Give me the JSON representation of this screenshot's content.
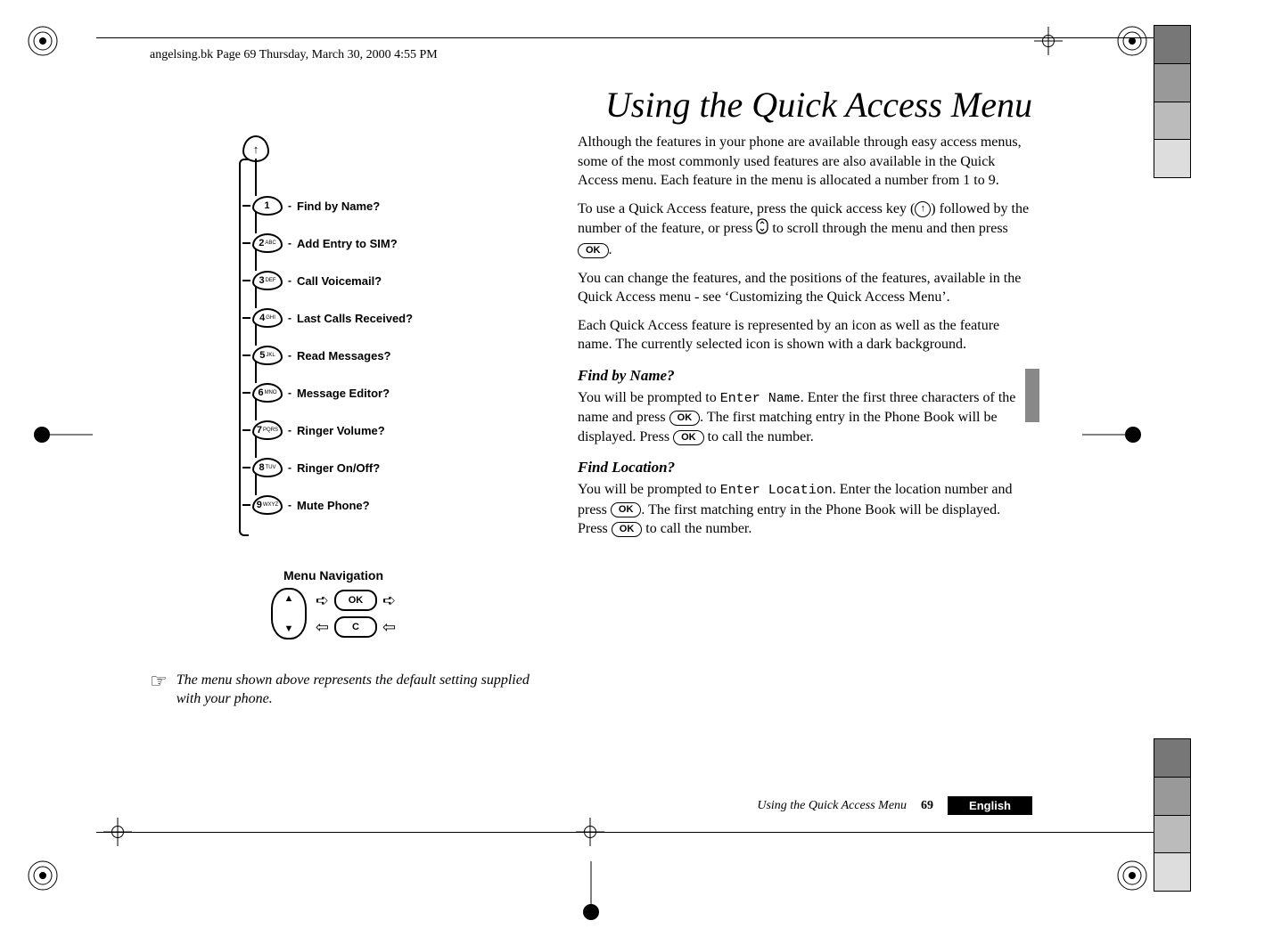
{
  "header_path": "angelsing.bk  Page 69  Thursday, March 30, 2000  4:55 PM",
  "title": "Using the Quick Access Menu",
  "menu_items": [
    {
      "key_num": "1",
      "key_letters": "",
      "label": "Find by Name?"
    },
    {
      "key_num": "2",
      "key_letters": "ABC",
      "label": "Add Entry to SIM?"
    },
    {
      "key_num": "3",
      "key_letters": "DEF",
      "label": "Call Voicemail?"
    },
    {
      "key_num": "4",
      "key_letters": "GHI",
      "label": "Last Calls Received?"
    },
    {
      "key_num": "5",
      "key_letters": "JKL",
      "label": "Read Messages?"
    },
    {
      "key_num": "6",
      "key_letters": "MNO",
      "label": "Message Editor?"
    },
    {
      "key_num": "7",
      "key_letters": "PQRS",
      "label": "Ringer Volume?"
    },
    {
      "key_num": "8",
      "key_letters": "TUV",
      "label": "Ringer On/Off?"
    },
    {
      "key_num": "9",
      "key_letters": "WXYZ",
      "label": "Mute Phone?"
    }
  ],
  "top_key_glyph": "↑",
  "nav_title": "Menu Navigation",
  "nav_ok": "OK",
  "nav_c": "C",
  "rocker_up": "▲",
  "rocker_down": "▼",
  "arrow_right": "➪",
  "arrow_left": "⇦",
  "note_text": "The menu shown above represents the default setting supplied with your phone.",
  "body": {
    "p1": "Although the features in your phone are available through easy access menus, some of the most commonly used features are also available in the Quick Access menu. Each feature in the menu is allocated a number from 1 to 9.",
    "p2a": "To use a Quick Access feature, press the quick access key (",
    "p2b": ") followed by the number of the feature, or press ",
    "p2c": " to scroll through the menu and then press ",
    "p2d": ".",
    "p3": "You can change the features, and the positions of the features, available in the Quick Access menu - see ‘Customizing the Quick Access Menu’.",
    "p4": "Each Quick Access feature is represented by an icon as well as the feature name. The currently selected icon is shown with a dark background.",
    "h_find_name": "Find by Name?",
    "fn_a": "You will be prompted to ",
    "fn_prompt": "Enter Name",
    "fn_b": ". Enter the first three characters of the name and press ",
    "fn_c": ". The first matching entry in the Phone Book will be displayed. Press ",
    "fn_d": " to call the number.",
    "h_find_loc": "Find Location?",
    "fl_a": "You will be prompted to ",
    "fl_prompt": "Enter Location",
    "fl_b": ". Enter the location number and press ",
    "fl_c": ". The first matching entry in the Phone Book will be displayed. Press ",
    "fl_d": " to call the number."
  },
  "ok_label": "OK",
  "qa_glyph": "↑",
  "footer": {
    "title": "Using the Quick Access Menu",
    "page": "69",
    "lang": "English"
  }
}
